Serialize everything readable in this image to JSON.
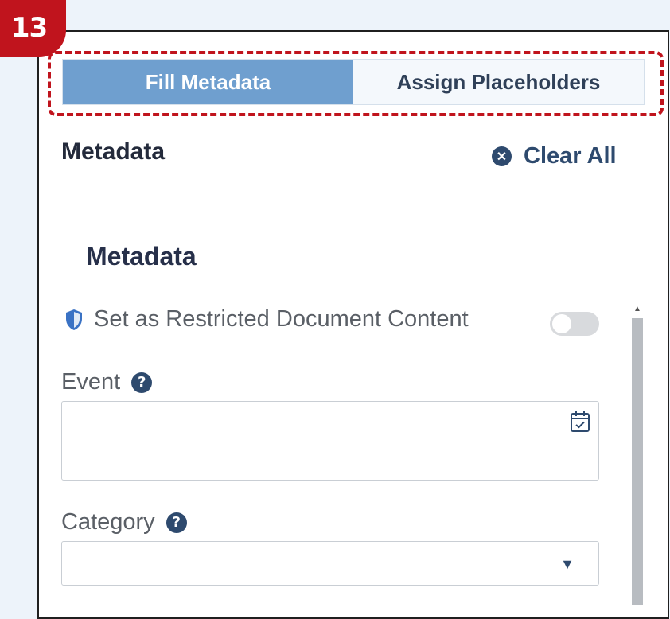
{
  "badge": "13",
  "tabs": [
    {
      "label": "Fill Metadata",
      "active": true
    },
    {
      "label": "Assign Placeholders",
      "active": false
    }
  ],
  "header": {
    "title": "Metadata",
    "clear_all": "Clear All"
  },
  "section": {
    "title": "Metadata"
  },
  "restricted": {
    "label": "Set as Restricted Document Content",
    "enabled": false
  },
  "fields": {
    "event": {
      "label": "Event",
      "value": ""
    },
    "category": {
      "label": "Category",
      "value": ""
    }
  },
  "colors": {
    "accent": "#6f9fcf",
    "highlight": "#c0141d",
    "icon": "#2e4a6e"
  }
}
